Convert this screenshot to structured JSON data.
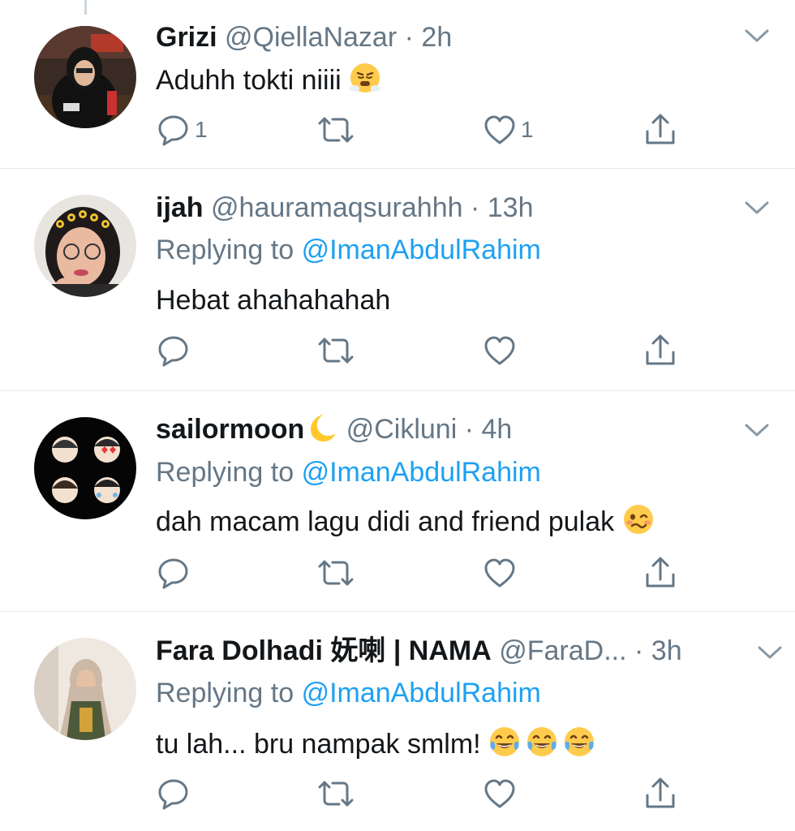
{
  "tweets": [
    {
      "name": "Grizi",
      "handle": "@QiellaNazar",
      "dot": "·",
      "time": "2h",
      "replying_label": "",
      "reply_mention": "",
      "text": "Aduhh tokti niiii",
      "emoji": [
        "triumph-face"
      ],
      "reply_count": "1",
      "retweet_count": "",
      "like_count": "1"
    },
    {
      "name": "ijah",
      "handle": "@hauramaqsurahhh",
      "dot": "·",
      "time": "13h",
      "replying_label": "Replying to",
      "reply_mention": "@ImanAbdulRahim",
      "text": "Hebat ahahahahah",
      "emoji": [],
      "reply_count": "",
      "retweet_count": "",
      "like_count": ""
    },
    {
      "name": "sailormoon",
      "name_emoji": "🌙",
      "handle": "@Cikluni",
      "dot": "·",
      "time": "4h",
      "replying_label": "Replying to",
      "reply_mention": "@ImanAbdulRahim",
      "text": "dah macam lagu didi and friend pulak",
      "emoji": [
        "woozy-face"
      ],
      "reply_count": "",
      "retweet_count": "",
      "like_count": ""
    },
    {
      "name": "Fara Dolhadi 妩喇 | NAMA",
      "handle": "@FaraD...",
      "dot": "·",
      "time": "3h",
      "replying_label": "Replying to",
      "reply_mention": "@ImanAbdulRahim",
      "text": "tu lah... bru nampak smlm!",
      "emoji": [
        "tears-of-joy",
        "tears-of-joy",
        "tears-of-joy"
      ],
      "reply_count": "",
      "retweet_count": "",
      "like_count": ""
    }
  ],
  "colors": {
    "primary_text": "#14171a",
    "secondary_text": "#657786",
    "link": "#1da1f2",
    "divider": "#e1e8ed"
  },
  "icons": [
    "reply-icon",
    "retweet-icon",
    "like-icon",
    "share-icon",
    "chevron-down-icon"
  ]
}
